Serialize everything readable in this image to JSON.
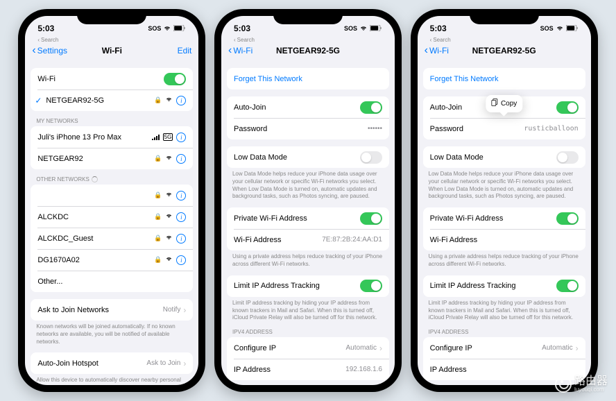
{
  "status": {
    "time": "5:03",
    "search_label": "Search",
    "sos": "SOS"
  },
  "phone1": {
    "back": "Settings",
    "title": "Wi-Fi",
    "edit": "Edit",
    "wifi_label": "Wi-Fi",
    "connected": "NETGEAR92-5G",
    "my_header": "MY NETWORKS",
    "my_networks": [
      {
        "name": "Juli's iPhone 13 Pro Max",
        "tag": "5G"
      },
      {
        "name": "NETGEAR92"
      }
    ],
    "other_header": "OTHER NETWORKS",
    "other_networks": [
      {
        "name": ""
      },
      {
        "name": "ALCKDC"
      },
      {
        "name": "ALCKDC_Guest"
      },
      {
        "name": "DG1670A02"
      },
      {
        "name": "Other..."
      }
    ],
    "ask_label": "Ask to Join Networks",
    "ask_value": "Notify",
    "ask_footer": "Known networks will be joined automatically. If no known networks are available, you will be notified of available networks.",
    "auto_label": "Auto-Join Hotspot",
    "auto_value": "Ask to Join",
    "auto_footer": "Allow this device to automatically discover nearby personal hotspots when no Wi-Fi network is available."
  },
  "detail": {
    "back": "Wi-Fi",
    "title": "NETGEAR92-5G",
    "forget": "Forget This Network",
    "autojoin": "Auto-Join",
    "password": "Password",
    "password_dots": "••••••",
    "password_clear": "rusticballoon",
    "lowdata": "Low Data Mode",
    "lowdata_footer": "Low Data Mode helps reduce your iPhone data usage over your cellular network or specific Wi-Fi networks you select. When Low Data Mode is turned on, automatic updates and background tasks, such as Photos syncing, are paused.",
    "private_wifi": "Private Wi-Fi Address",
    "wifi_addr_label": "Wi-Fi Address",
    "wifi_addr_value": "7E:87:2B:24:AA:D1",
    "private_footer": "Using a private address helps reduce tracking of your iPhone across different Wi-Fi networks.",
    "limit_ip": "Limit IP Address Tracking",
    "limit_footer": "Limit IP address tracking by hiding your IP address from known trackers in Mail and Safari. When this is turned off, iCloud Private Relay will also be turned off for this network.",
    "ipv4_header": "IPV4 ADDRESS",
    "config_ip": "Configure IP",
    "config_ip_value": "Automatic",
    "ip_addr": "IP Address",
    "ip_addr_value": "192.168.1.6",
    "copy": "Copy"
  },
  "watermark": {
    "main": "路由器",
    "sub": "luyouqi.com"
  }
}
